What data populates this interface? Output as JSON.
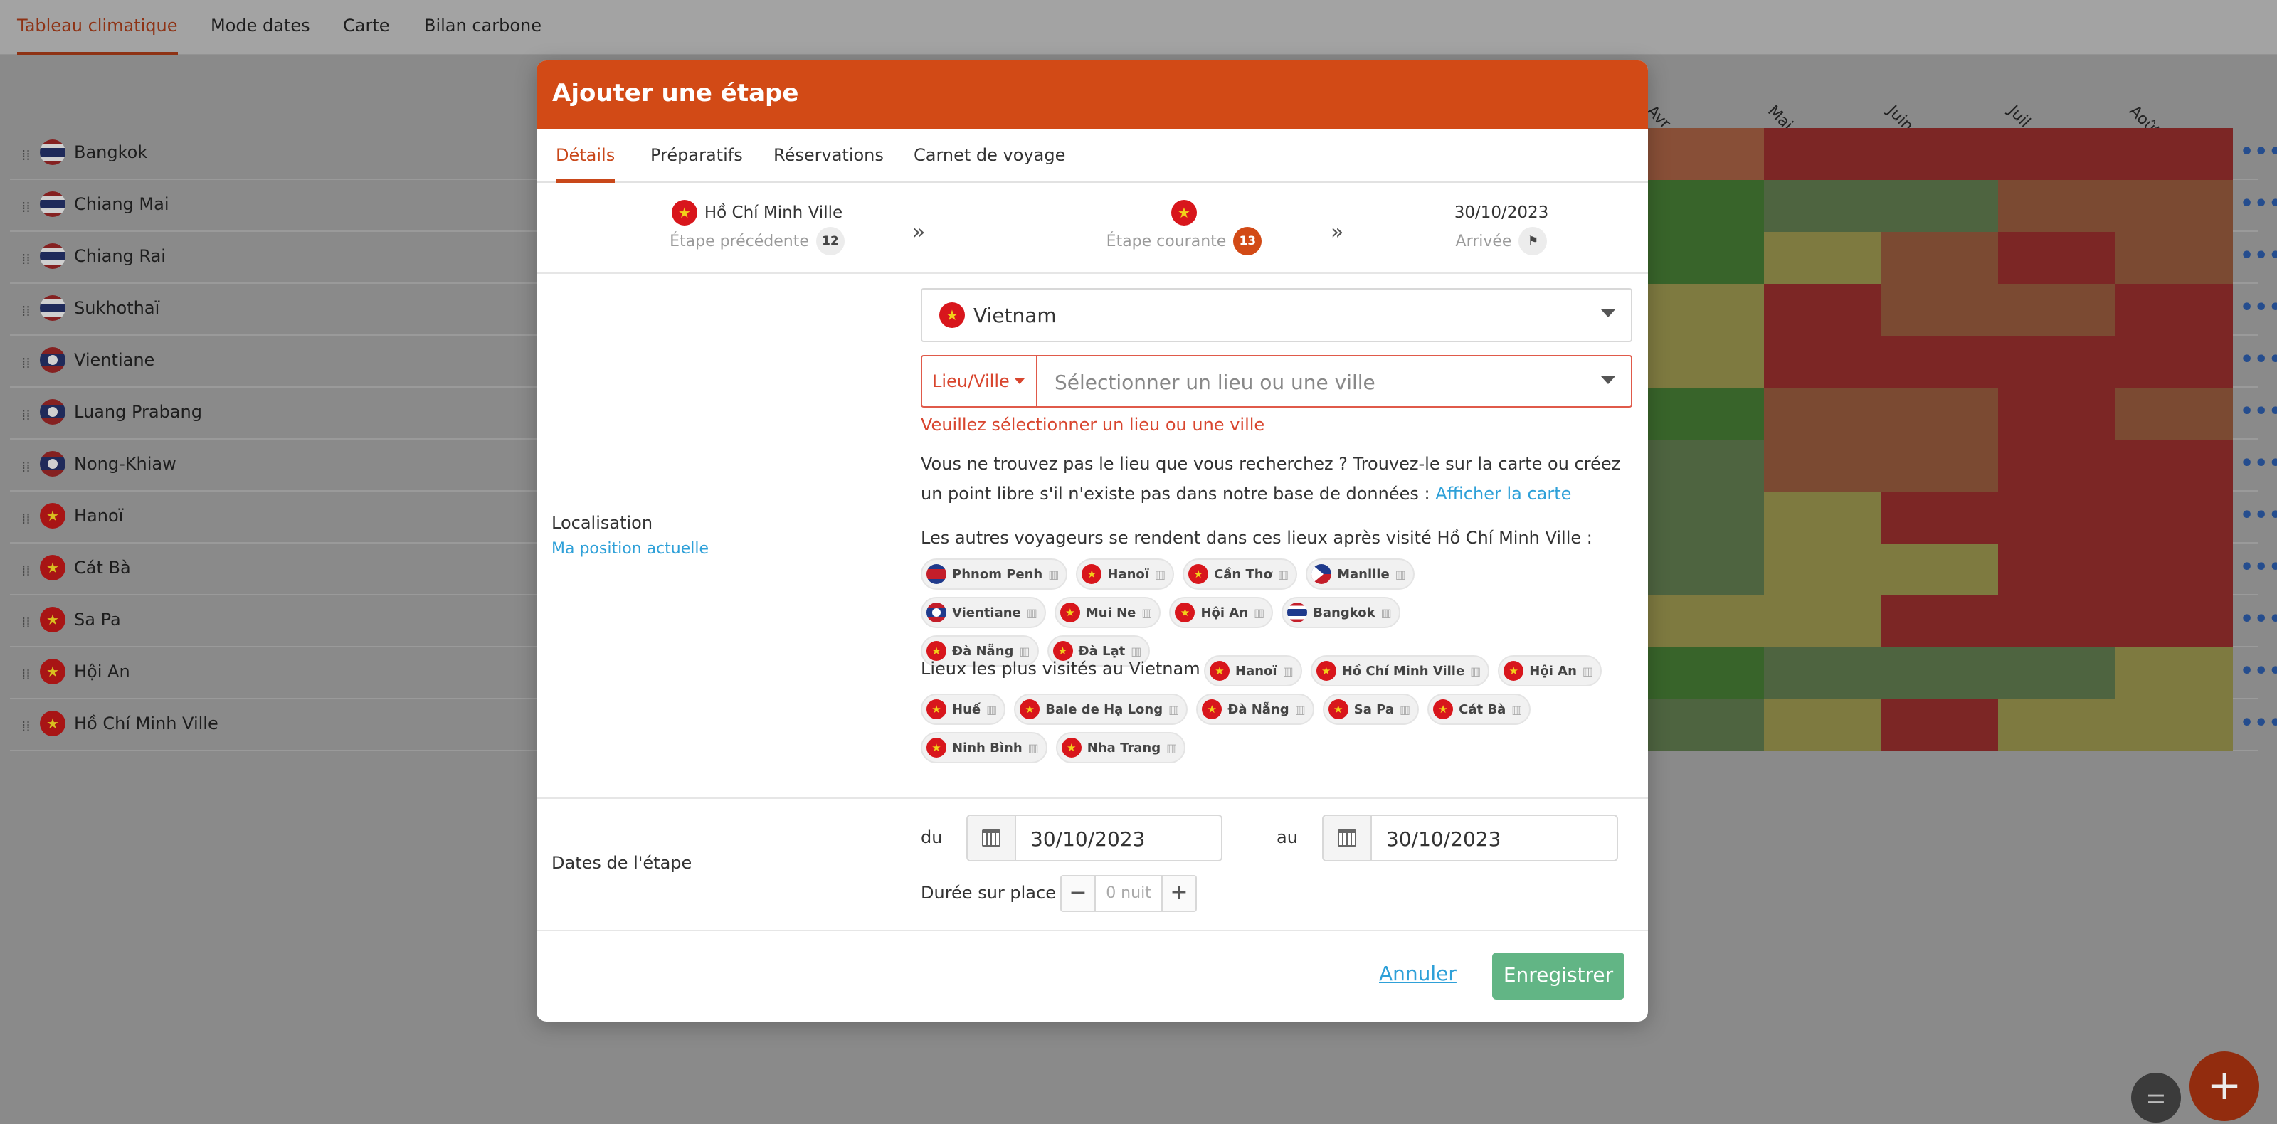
{
  "nav": {
    "tabs": [
      "Tableau climatique",
      "Mode dates",
      "Carte",
      "Bilan carbone"
    ]
  },
  "months": [
    "Avr.",
    "Mai",
    "Juin",
    "Juil.",
    "Août"
  ],
  "rows": [
    {
      "name": "Bangkok",
      "flag": "thailand",
      "cells": [
        "#884f37",
        "#7c2625",
        "#7c2625",
        "#7c2625",
        "#7c2625"
      ]
    },
    {
      "name": "Chiang Mai",
      "flag": "thailand",
      "cells": [
        "#38642a",
        "#4e6440",
        "#4e6440",
        "#7b4a32",
        "#7b4a32"
      ]
    },
    {
      "name": "Chiang Rai",
      "flag": "thailand",
      "cells": [
        "#38642a",
        "#7e7a40",
        "#7b4a32",
        "#7c2625",
        "#7b4a32"
      ]
    },
    {
      "name": "Sukhothaï",
      "flag": "thailand",
      "cells": [
        "#7e7a40",
        "#7c2625",
        "#7b4a32",
        "#7b4a32",
        "#7c2625"
      ]
    },
    {
      "name": "Vientiane",
      "flag": "laos",
      "cells": [
        "#7e7a40",
        "#7c2625",
        "#7c2625",
        "#7c2625",
        "#7c2625"
      ]
    },
    {
      "name": "Luang Prabang",
      "flag": "laos",
      "cells": [
        "#38642a",
        "#7b4a32",
        "#7b4a32",
        "#7c2625",
        "#7b4a32"
      ]
    },
    {
      "name": "Nong-Khiaw",
      "flag": "laos",
      "cells": [
        "#4e6440",
        "#7b4a32",
        "#7b4a32",
        "#7c2625",
        "#7c2625"
      ]
    },
    {
      "name": "Hanoï",
      "flag": "vietnam",
      "cells": [
        "#4e6440",
        "#7e7a40",
        "#7c2625",
        "#7c2625",
        "#7c2625"
      ]
    },
    {
      "name": "Cát Bà",
      "flag": "vietnam",
      "cells": [
        "#4e6440",
        "#7e7a40",
        "#7e7a40",
        "#7c2625",
        "#7c2625"
      ]
    },
    {
      "name": "Sa Pa",
      "flag": "vietnam",
      "cells": [
        "#7e7a40",
        "#7e7a40",
        "#7c2625",
        "#7c2625",
        "#7c2625"
      ]
    },
    {
      "name": "Hội An",
      "flag": "vietnam",
      "cells": [
        "#38642a",
        "#4e6440",
        "#4e6440",
        "#4e6440",
        "#7e7a40"
      ]
    },
    {
      "name": "Hồ Chí Minh Ville",
      "flag": "vietnam",
      "cells": [
        "#4e6440",
        "#7e7a40",
        "#7c2625",
        "#7e7a40",
        "#7e7a40"
      ]
    }
  ],
  "modal": {
    "title": "Ajouter une étape",
    "tabs": [
      "Détails",
      "Préparatifs",
      "Réservations",
      "Carnet de voyage"
    ],
    "stepper": {
      "previous_place": "Hồ Chí Minh Ville",
      "previous_label": "Étape précédente",
      "previous_count": "12",
      "current_label": "Étape courante",
      "current_count": "13",
      "arrival_date": "30/10/2023",
      "arrival_label": "Arrivée"
    },
    "localisation": {
      "label": "Localisation",
      "my_position": "Ma position actuelle",
      "country": "Vietnam",
      "place_type": "Lieu/Ville",
      "place_placeholder": "Sélectionner un lieu ou une ville",
      "error": "Veuillez sélectionner un lieu ou une ville",
      "help_text": "Vous ne trouvez pas le lieu que vous recherchez ? Trouvez-le sur la carte ou créez un point libre s'il n'existe pas dans notre base de données :",
      "help_link": "Afficher la carte",
      "others_title": "Les autres voyageurs se rendent dans ces lieux après visité Hồ Chí Minh Ville :",
      "others": [
        {
          "name": "Phnom Penh",
          "flag": "cambodia"
        },
        {
          "name": "Hanoï",
          "flag": "vietnam"
        },
        {
          "name": "Cần Thơ",
          "flag": "vietnam"
        },
        {
          "name": "Manille",
          "flag": "philippines"
        },
        {
          "name": "Vientiane",
          "flag": "laos"
        },
        {
          "name": "Mui Ne",
          "flag": "vietnam"
        },
        {
          "name": "Hội An",
          "flag": "vietnam"
        },
        {
          "name": "Bangkok",
          "flag": "thailand"
        },
        {
          "name": "Đà Nẵng",
          "flag": "vietnam"
        },
        {
          "name": "Đà Lạt",
          "flag": "vietnam"
        }
      ],
      "popular_title": "Lieux les plus visités au Vietnam :",
      "popular": [
        {
          "name": "Hanoï",
          "flag": "vietnam"
        },
        {
          "name": "Hồ Chí Minh Ville",
          "flag": "vietnam"
        },
        {
          "name": "Hội An",
          "flag": "vietnam"
        },
        {
          "name": "Huế",
          "flag": "vietnam"
        },
        {
          "name": "Baie de Hạ Long",
          "flag": "vietnam"
        },
        {
          "name": "Đà Nẵng",
          "flag": "vietnam"
        },
        {
          "name": "Sa Pa",
          "flag": "vietnam"
        },
        {
          "name": "Cát Bà",
          "flag": "vietnam"
        },
        {
          "name": "Ninh Bình",
          "flag": "vietnam"
        },
        {
          "name": "Nha Trang",
          "flag": "vietnam"
        }
      ]
    },
    "dates": {
      "label": "Dates de l'étape",
      "from_label": "du",
      "from_value": "30/10/2023",
      "to_label": "au",
      "to_value": "30/10/2023",
      "duration_label": "Durée sur place",
      "duration_value": "0 nuit"
    },
    "footer": {
      "cancel": "Annuler",
      "save": "Enregistrer"
    }
  },
  "colors": {
    "brand": "#d24a16",
    "save_button": "#62b585",
    "link": "#2ea0d8",
    "error": "#d8452e"
  },
  "icons": {
    "drag": "drag-handle-icon",
    "more": "more-dots-icon",
    "calendar": "calendar-icon",
    "building": "building-icon",
    "flag_finish": "finish-flag-icon",
    "settings": "sliders-icon",
    "add": "plus-icon"
  }
}
